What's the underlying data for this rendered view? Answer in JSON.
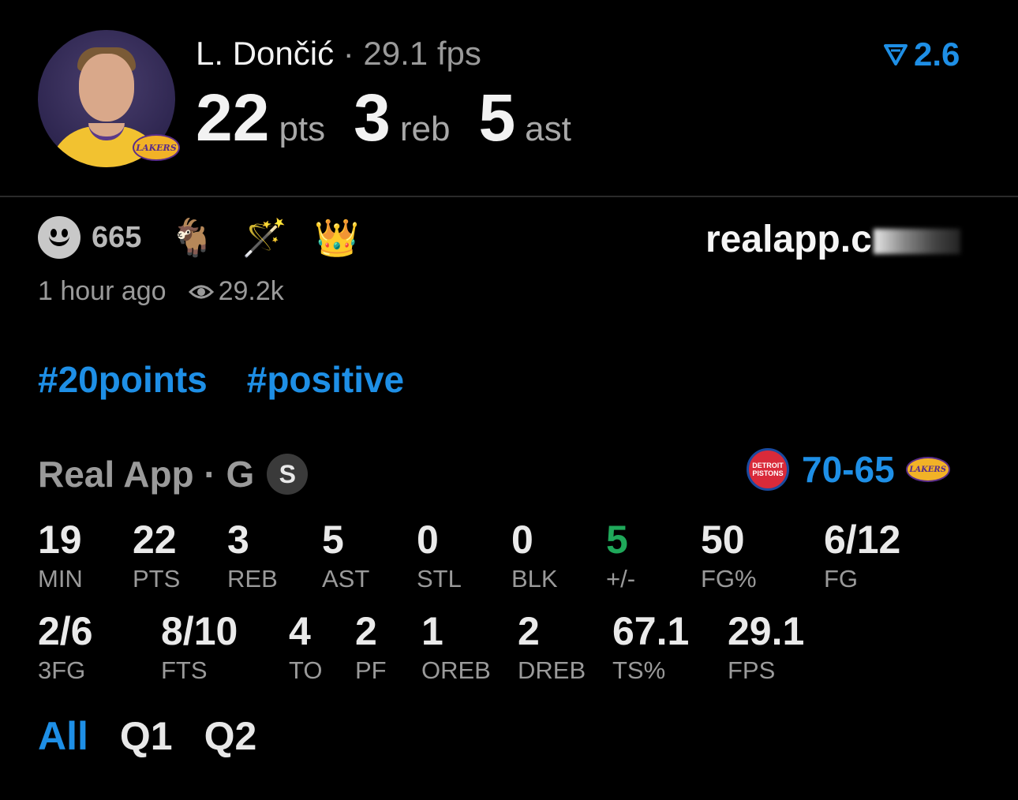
{
  "player": {
    "name": "L. Dončić",
    "separator": "·",
    "fps": "29.1 fps",
    "avatar_badge": "LAKERS"
  },
  "rating": {
    "value": "2.6",
    "icon": "rating-triangle-icon"
  },
  "big_stats": [
    {
      "value": "22",
      "unit": "pts"
    },
    {
      "value": "3",
      "unit": "reb"
    },
    {
      "value": "5",
      "unit": "ast"
    }
  ],
  "reactions": {
    "count": "665",
    "emojis": [
      "🐐",
      "🪄",
      "👑"
    ]
  },
  "watermark": {
    "text": "realapp.c"
  },
  "meta": {
    "time": "1 hour ago",
    "views": "29.2k"
  },
  "hashtags": [
    "#20points",
    "#positive"
  ],
  "game": {
    "label": "Real App · G",
    "badge": "S",
    "home_logo": "DETROIT PISTONS",
    "score": "70-65",
    "away_logo": "LAKERS"
  },
  "stats_row1": [
    {
      "value": "19",
      "label": "MIN"
    },
    {
      "value": "22",
      "label": "PTS"
    },
    {
      "value": "3",
      "label": "REB"
    },
    {
      "value": "5",
      "label": "AST"
    },
    {
      "value": "0",
      "label": "STL"
    },
    {
      "value": "0",
      "label": "BLK"
    },
    {
      "value": "5",
      "label": "+/-",
      "color": "#1fa85a"
    },
    {
      "value": "50",
      "label": "FG%"
    },
    {
      "value": "6/12",
      "label": "FG"
    }
  ],
  "stats_row2": [
    {
      "value": "2/6",
      "label": "3FG"
    },
    {
      "value": "8/10",
      "label": "FTS"
    },
    {
      "value": "4",
      "label": "TO"
    },
    {
      "value": "2",
      "label": "PF"
    },
    {
      "value": "1",
      "label": "OREB"
    },
    {
      "value": "2",
      "label": "DREB"
    },
    {
      "value": "67.1",
      "label": "TS%"
    },
    {
      "value": "29.1",
      "label": "FPS"
    }
  ],
  "periods": [
    {
      "label": "All",
      "active": true
    },
    {
      "label": "Q1",
      "active": false
    },
    {
      "label": "Q2",
      "active": false
    }
  ],
  "colors": {
    "accent": "#1e8fe6",
    "positive": "#1fa85a",
    "muted": "#9a9a9a",
    "background": "#000000"
  }
}
